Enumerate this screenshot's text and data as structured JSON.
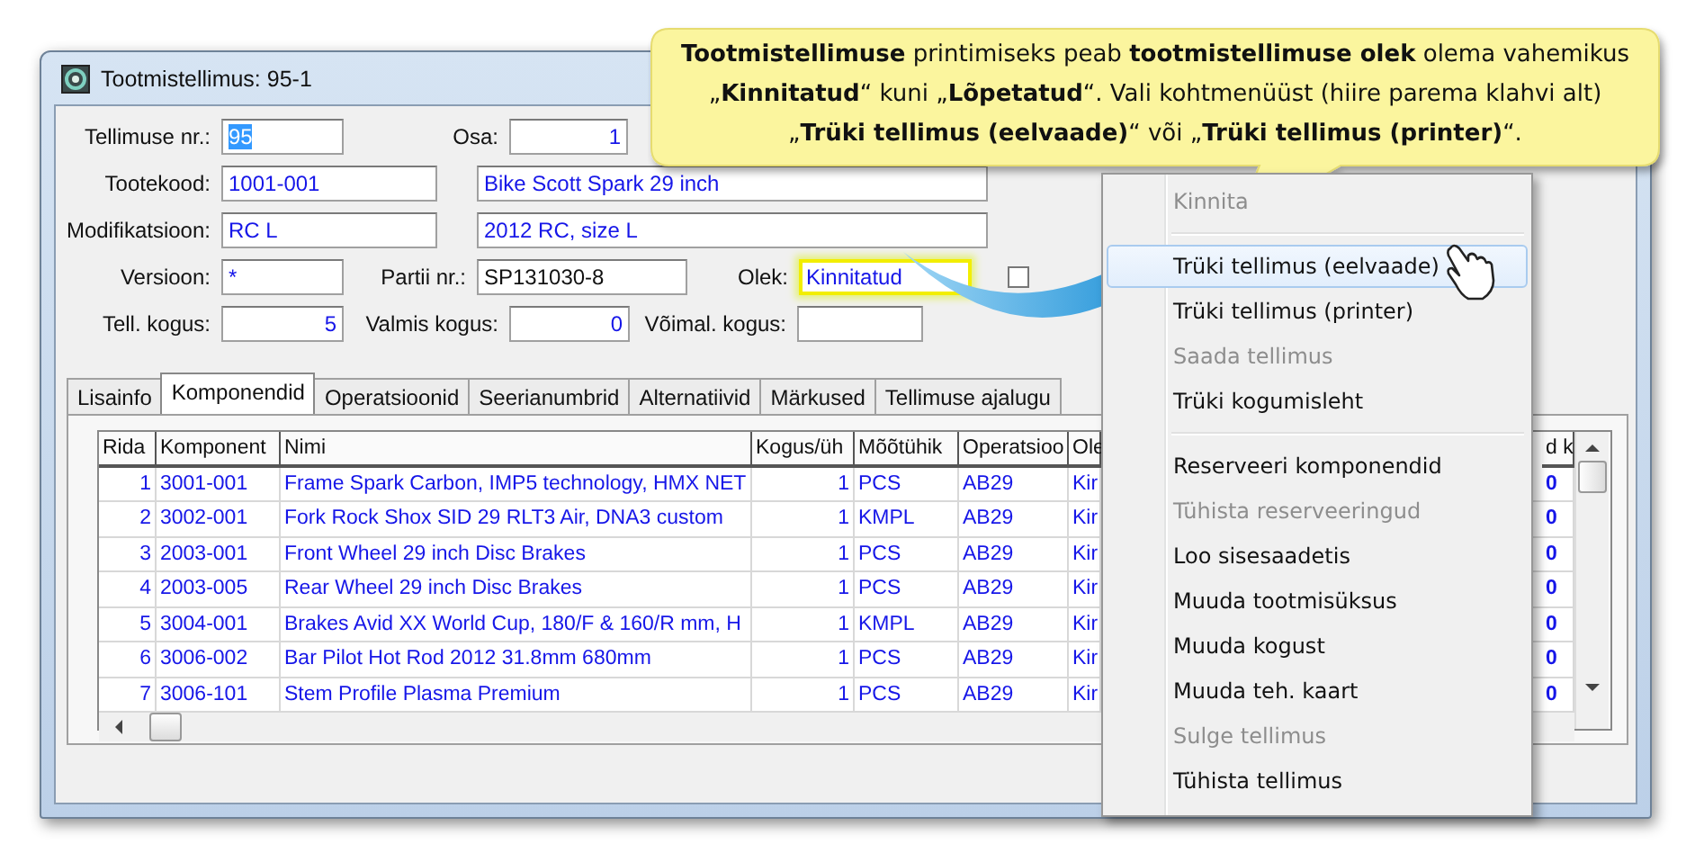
{
  "window": {
    "title": "Tootmistellimus: 95-1"
  },
  "form": {
    "rows": [
      [
        {
          "label": "Tellimuse nr.:",
          "value": "95",
          "kind": "text",
          "text_selected": true,
          "highlighted": false
        },
        {
          "label": "Osa:",
          "value": "1",
          "kind": "number",
          "text_selected": false,
          "highlighted": false
        }
      ],
      [
        {
          "label": "Tootekood:",
          "value": "1001-001",
          "kind": "text",
          "text_selected": false,
          "highlighted": false
        },
        {
          "value": "Bike Scott Spark 29 inch",
          "kind": "text",
          "text_selected": false,
          "highlighted": false
        }
      ],
      [
        {
          "label": "Modifikatsioon:",
          "value": "RC L",
          "kind": "text",
          "text_selected": false,
          "highlighted": false
        },
        {
          "value": "2012 RC, size L",
          "kind": "text",
          "text_selected": false,
          "highlighted": false
        }
      ],
      [
        {
          "label": "Versioon:",
          "value": "*",
          "kind": "text",
          "text_selected": false,
          "highlighted": false
        },
        {
          "label": "Partii nr.:",
          "value": "SP131030-8",
          "kind": "entry",
          "text_selected": false,
          "highlighted": false
        },
        {
          "label": "Olek:",
          "value": "Kinnitatud",
          "kind": "text",
          "text_selected": false,
          "highlighted": true
        }
      ],
      [
        {
          "label": "Tell. kogus:",
          "value": "5",
          "kind": "number",
          "text_selected": false,
          "highlighted": false
        },
        {
          "label": "Valmis kogus:",
          "value": "0",
          "kind": "number",
          "text_selected": false,
          "highlighted": false
        },
        {
          "label": "Võimal. kogus:",
          "kind": "number",
          "highlighted": false
        }
      ]
    ],
    "checkbox": {
      "checked": false
    }
  },
  "tabs": [
    {
      "label": "Lisainfo",
      "selected": false
    },
    {
      "label": "Komponendid",
      "selected": true
    },
    {
      "label": "Operatsioonid",
      "selected": false
    },
    {
      "label": "Seerianumbrid",
      "selected": false
    },
    {
      "label": "Alternatiivid",
      "selected": false
    },
    {
      "label": "Märkused",
      "selected": false
    },
    {
      "label": "Tellimuse ajalugu",
      "selected": false
    }
  ],
  "table": {
    "columns": [
      "Rida",
      "Komponent",
      "Nimi",
      "Kogus/üh",
      "Mõõtühik",
      "Operatsioo",
      "Ole",
      "d k"
    ],
    "rows": [
      [
        "1",
        "3001-001",
        "Frame Spark Carbon, IMP5 technology, HMX NET",
        "1",
        "PCS",
        "AB29",
        "Kir",
        "0"
      ],
      [
        "2",
        "3002-001",
        "Fork Rock Shox SID 29 RLT3 Air, DNA3 custom",
        "1",
        "KMPL",
        "AB29",
        "Kir",
        "0"
      ],
      [
        "3",
        "2003-001",
        "Front Wheel 29 inch Disc Brakes",
        "1",
        "PCS",
        "AB29",
        "Kir",
        "0"
      ],
      [
        "4",
        "2003-005",
        "Rear Wheel 29 inch Disc Brakes",
        "1",
        "PCS",
        "AB29",
        "Kir",
        "0"
      ],
      [
        "5",
        "3004-001",
        "Brakes Avid XX World Cup, 180/F & 160/R mm, H",
        "1",
        "KMPL",
        "AB29",
        "Kir",
        "0"
      ],
      [
        "6",
        "3006-002",
        "Bar Pilot Hot Rod 2012 31.8mm 680mm",
        "1",
        "PCS",
        "AB29",
        "Kir",
        "0"
      ],
      [
        "7",
        "3006-101",
        "Stem Profile Plasma Premium",
        "1",
        "PCS",
        "AB29",
        "Kir",
        "0"
      ]
    ]
  },
  "context_menu": {
    "items": [
      {
        "kind": "item",
        "label": "Kinnita",
        "disabled": true,
        "selected": false
      },
      {
        "kind": "separator"
      },
      {
        "kind": "item",
        "label": "Trüki tellimus (eelvaade)",
        "disabled": false,
        "selected": true
      },
      {
        "kind": "item",
        "label": "Trüki tellimus (printer)",
        "disabled": false,
        "selected": false
      },
      {
        "kind": "item",
        "label": "Saada tellimus",
        "disabled": true,
        "selected": false
      },
      {
        "kind": "item",
        "label": "Trüki kogumisleht",
        "disabled": false,
        "selected": false
      },
      {
        "kind": "separator"
      },
      {
        "kind": "item",
        "label": "Reserveeri komponendid",
        "disabled": false,
        "selected": false
      },
      {
        "kind": "item",
        "label": "Tühista reserveeringud",
        "disabled": true,
        "selected": false
      },
      {
        "kind": "item",
        "label": "Loo sisesaadetis",
        "disabled": false,
        "selected": false
      },
      {
        "kind": "item",
        "label": "Muuda tootmisüksus",
        "disabled": false,
        "selected": false
      },
      {
        "kind": "item",
        "label": "Muuda kogust",
        "disabled": false,
        "selected": false
      },
      {
        "kind": "item",
        "label": "Muuda teh. kaart",
        "disabled": false,
        "selected": false
      },
      {
        "kind": "item",
        "label": "Sulge tellimus",
        "disabled": true,
        "selected": false
      },
      {
        "kind": "item",
        "label": "Tühista tellimus",
        "disabled": false,
        "selected": false
      }
    ]
  },
  "callout": {
    "text": "**Tootmistellimuse** printimiseks peab **tootmistellimuse olek** olema vahemikus „**Kinnitatud**“ kuni „**Lõpetatud**“. Vali kohtmenüüst (hiire parema klahvi alt) „**Trüki tellimus (eelvaade)**“ või „**Trüki tellimus (printer)**“."
  }
}
